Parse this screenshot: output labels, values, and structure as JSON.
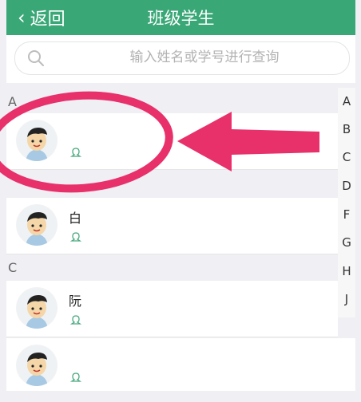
{
  "header": {
    "back_label": "返回",
    "title": "班级学生"
  },
  "search": {
    "placeholder": "输入姓名或学号进行查询"
  },
  "sections": [
    {
      "letter": "A"
    },
    {
      "letter": "C"
    }
  ],
  "students": [
    {
      "name": "",
      "extra": ""
    },
    {
      "name": "白",
      "extra": ""
    },
    {
      "name": "阮",
      "extra": ""
    },
    {
      "name": "",
      "extra": ""
    }
  ],
  "index_letters": [
    "A",
    "B",
    "C",
    "D",
    "F",
    "G",
    "H",
    "J"
  ],
  "colors": {
    "header": "#3aa777",
    "annotation": "#e8306b",
    "status": "#4aa97f"
  }
}
